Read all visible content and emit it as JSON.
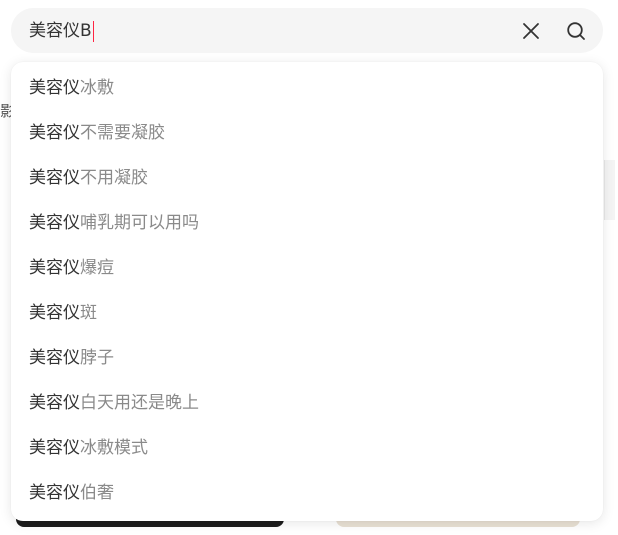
{
  "search": {
    "query": "美容仪B",
    "clear_icon": "close-icon",
    "search_icon": "search-icon"
  },
  "suggestions": {
    "keyword": "美容仪",
    "items": [
      {
        "match": "美容仪",
        "rest": "冰敷"
      },
      {
        "match": "美容仪",
        "rest": "不需要凝胶"
      },
      {
        "match": "美容仪",
        "rest": "不用凝胶"
      },
      {
        "match": "美容仪",
        "rest": "哺乳期可以用吗"
      },
      {
        "match": "美容仪",
        "rest": "爆痘"
      },
      {
        "match": "美容仪",
        "rest": "斑"
      },
      {
        "match": "美容仪",
        "rest": "脖子"
      },
      {
        "match": "美容仪",
        "rest": "白天用还是晚上"
      },
      {
        "match": "美容仪",
        "rest": "冰敷模式"
      },
      {
        "match": "美容仪",
        "rest": "伯奢"
      }
    ]
  },
  "background": {
    "left_glyph": "影"
  },
  "colors": {
    "caret": "#ff2442",
    "match_text": "#333333",
    "rest_text": "#8a8a8a",
    "search_bg": "#f5f5f5"
  }
}
